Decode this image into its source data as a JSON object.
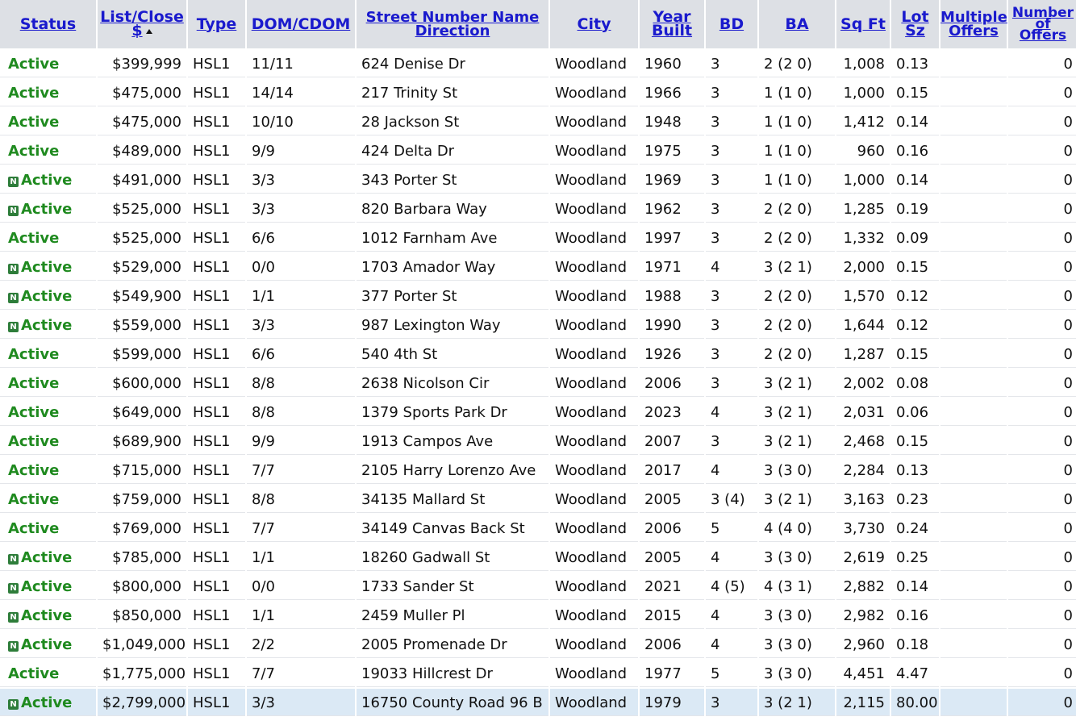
{
  "headers": {
    "status": "Status",
    "list_close_line1": "List/Close",
    "list_close_line2": "$",
    "type": "Type",
    "dom_cdom": "DOM/CDOM",
    "street_line1": "Street Number Name",
    "street_line2": "Direction",
    "city": "City",
    "year_line1": "Year",
    "year_line2": "Built",
    "bd": "BD",
    "ba": "BA",
    "sqft": "Sq Ft",
    "lot_line1": "Lot",
    "lot_line2": "Sz",
    "multiple_line1": "Multiple",
    "multiple_line2": "Offers",
    "number_line1": "Number",
    "number_line2": "of",
    "number_line3": "Offers"
  },
  "new_badge": "N",
  "sort_icon": "sort-ascending-icon",
  "rows": [
    {
      "status": "Active",
      "new": false,
      "price": "$399,999",
      "type": "HSL1",
      "dom": "11/11",
      "street": "624 Denise Dr",
      "city": "Woodland",
      "year": "1960",
      "bd": "3",
      "ba": "2 (2 0)",
      "sqft": "1,008",
      "lot": "0.13",
      "multiple": "",
      "offers": "0"
    },
    {
      "status": "Active",
      "new": false,
      "price": "$475,000",
      "type": "HSL1",
      "dom": "14/14",
      "street": "217 Trinity St",
      "city": "Woodland",
      "year": "1966",
      "bd": "3",
      "ba": "1 (1 0)",
      "sqft": "1,000",
      "lot": "0.15",
      "multiple": "",
      "offers": "0"
    },
    {
      "status": "Active",
      "new": false,
      "price": "$475,000",
      "type": "HSL1",
      "dom": "10/10",
      "street": "28 Jackson St",
      "city": "Woodland",
      "year": "1948",
      "bd": "3",
      "ba": "1 (1 0)",
      "sqft": "1,412",
      "lot": "0.14",
      "multiple": "",
      "offers": "0"
    },
    {
      "status": "Active",
      "new": false,
      "price": "$489,000",
      "type": "HSL1",
      "dom": "9/9",
      "street": "424 Delta Dr",
      "city": "Woodland",
      "year": "1975",
      "bd": "3",
      "ba": "1 (1 0)",
      "sqft": "960",
      "lot": "0.16",
      "multiple": "",
      "offers": "0"
    },
    {
      "status": "Active",
      "new": true,
      "price": "$491,000",
      "type": "HSL1",
      "dom": "3/3",
      "street": "343 Porter St",
      "city": "Woodland",
      "year": "1969",
      "bd": "3",
      "ba": "1 (1 0)",
      "sqft": "1,000",
      "lot": "0.14",
      "multiple": "",
      "offers": "0"
    },
    {
      "status": "Active",
      "new": true,
      "price": "$525,000",
      "type": "HSL1",
      "dom": "3/3",
      "street": "820 Barbara Way",
      "city": "Woodland",
      "year": "1962",
      "bd": "3",
      "ba": "2 (2 0)",
      "sqft": "1,285",
      "lot": "0.19",
      "multiple": "",
      "offers": "0"
    },
    {
      "status": "Active",
      "new": false,
      "price": "$525,000",
      "type": "HSL1",
      "dom": "6/6",
      "street": "1012 Farnham Ave",
      "city": "Woodland",
      "year": "1997",
      "bd": "3",
      "ba": "2 (2 0)",
      "sqft": "1,332",
      "lot": "0.09",
      "multiple": "",
      "offers": "0"
    },
    {
      "status": "Active",
      "new": true,
      "price": "$529,000",
      "type": "HSL1",
      "dom": "0/0",
      "street": "1703 Amador Way",
      "city": "Woodland",
      "year": "1971",
      "bd": "4",
      "ba": "3 (2 1)",
      "sqft": "2,000",
      "lot": "0.15",
      "multiple": "",
      "offers": "0"
    },
    {
      "status": "Active",
      "new": true,
      "price": "$549,900",
      "type": "HSL1",
      "dom": "1/1",
      "street": "377 Porter St",
      "city": "Woodland",
      "year": "1988",
      "bd": "3",
      "ba": "2 (2 0)",
      "sqft": "1,570",
      "lot": "0.12",
      "multiple": "",
      "offers": "0"
    },
    {
      "status": "Active",
      "new": true,
      "price": "$559,000",
      "type": "HSL1",
      "dom": "3/3",
      "street": "987 Lexington Way",
      "city": "Woodland",
      "year": "1990",
      "bd": "3",
      "ba": "2 (2 0)",
      "sqft": "1,644",
      "lot": "0.12",
      "multiple": "",
      "offers": "0"
    },
    {
      "status": "Active",
      "new": false,
      "price": "$599,000",
      "type": "HSL1",
      "dom": "6/6",
      "street": "540 4th St",
      "city": "Woodland",
      "year": "1926",
      "bd": "3",
      "ba": "2 (2 0)",
      "sqft": "1,287",
      "lot": "0.15",
      "multiple": "",
      "offers": "0"
    },
    {
      "status": "Active",
      "new": false,
      "price": "$600,000",
      "type": "HSL1",
      "dom": "8/8",
      "street": "2638 Nicolson Cir",
      "city": "Woodland",
      "year": "2006",
      "bd": "3",
      "ba": "3 (2 1)",
      "sqft": "2,002",
      "lot": "0.08",
      "multiple": "",
      "offers": "0"
    },
    {
      "status": "Active",
      "new": false,
      "price": "$649,000",
      "type": "HSL1",
      "dom": "8/8",
      "street": "1379 Sports Park Dr",
      "city": "Woodland",
      "year": "2023",
      "bd": "4",
      "ba": "3 (2 1)",
      "sqft": "2,031",
      "lot": "0.06",
      "multiple": "",
      "offers": "0"
    },
    {
      "status": "Active",
      "new": false,
      "price": "$689,900",
      "type": "HSL1",
      "dom": "9/9",
      "street": "1913 Campos Ave",
      "city": "Woodland",
      "year": "2007",
      "bd": "3",
      "ba": "3 (2 1)",
      "sqft": "2,468",
      "lot": "0.15",
      "multiple": "",
      "offers": "0"
    },
    {
      "status": "Active",
      "new": false,
      "price": "$715,000",
      "type": "HSL1",
      "dom": "7/7",
      "street": "2105 Harry Lorenzo Ave",
      "city": "Woodland",
      "year": "2017",
      "bd": "4",
      "ba": "3 (3 0)",
      "sqft": "2,284",
      "lot": "0.13",
      "multiple": "",
      "offers": "0"
    },
    {
      "status": "Active",
      "new": false,
      "price": "$759,000",
      "type": "HSL1",
      "dom": "8/8",
      "street": "34135 Mallard St",
      "city": "Woodland",
      "year": "2005",
      "bd": "3 (4)",
      "ba": "3 (2 1)",
      "sqft": "3,163",
      "lot": "0.23",
      "multiple": "",
      "offers": "0"
    },
    {
      "status": "Active",
      "new": false,
      "price": "$769,000",
      "type": "HSL1",
      "dom": "7/7",
      "street": "34149 Canvas Back St",
      "city": "Woodland",
      "year": "2006",
      "bd": "5",
      "ba": "4 (4 0)",
      "sqft": "3,730",
      "lot": "0.24",
      "multiple": "",
      "offers": "0"
    },
    {
      "status": "Active",
      "new": true,
      "price": "$785,000",
      "type": "HSL1",
      "dom": "1/1",
      "street": "18260 Gadwall St",
      "city": "Woodland",
      "year": "2005",
      "bd": "4",
      "ba": "3 (3 0)",
      "sqft": "2,619",
      "lot": "0.25",
      "multiple": "",
      "offers": "0"
    },
    {
      "status": "Active",
      "new": true,
      "price": "$800,000",
      "type": "HSL1",
      "dom": "0/0",
      "street": "1733 Sander St",
      "city": "Woodland",
      "year": "2021",
      "bd": "4 (5)",
      "ba": "4 (3 1)",
      "sqft": "2,882",
      "lot": "0.14",
      "multiple": "",
      "offers": "0"
    },
    {
      "status": "Active",
      "new": true,
      "price": "$850,000",
      "type": "HSL1",
      "dom": "1/1",
      "street": "2459 Muller Pl",
      "city": "Woodland",
      "year": "2015",
      "bd": "4",
      "ba": "3 (3 0)",
      "sqft": "2,982",
      "lot": "0.16",
      "multiple": "",
      "offers": "0"
    },
    {
      "status": "Active",
      "new": true,
      "price": "$1,049,000",
      "type": "HSL1",
      "dom": "2/2",
      "street": "2005 Promenade Dr",
      "city": "Woodland",
      "year": "2006",
      "bd": "4",
      "ba": "3 (3 0)",
      "sqft": "2,960",
      "lot": "0.18",
      "multiple": "",
      "offers": "0"
    },
    {
      "status": "Active",
      "new": false,
      "price": "$1,775,000",
      "type": "HSL1",
      "dom": "7/7",
      "street": "19033 Hillcrest Dr",
      "city": "Woodland",
      "year": "1977",
      "bd": "5",
      "ba": "3 (3 0)",
      "sqft": "4,451",
      "lot": "4.47",
      "multiple": "",
      "offers": "0"
    },
    {
      "status": "Active",
      "new": true,
      "selected": true,
      "price": "$2,799,000",
      "type": "HSL1",
      "dom": "3/3",
      "street": "16750 County Road 96 B",
      "city": "Woodland",
      "year": "1979",
      "bd": "3",
      "ba": "3 (2 1)",
      "sqft": "2,115",
      "lot": "80.00",
      "multiple": "",
      "offers": "0"
    }
  ]
}
